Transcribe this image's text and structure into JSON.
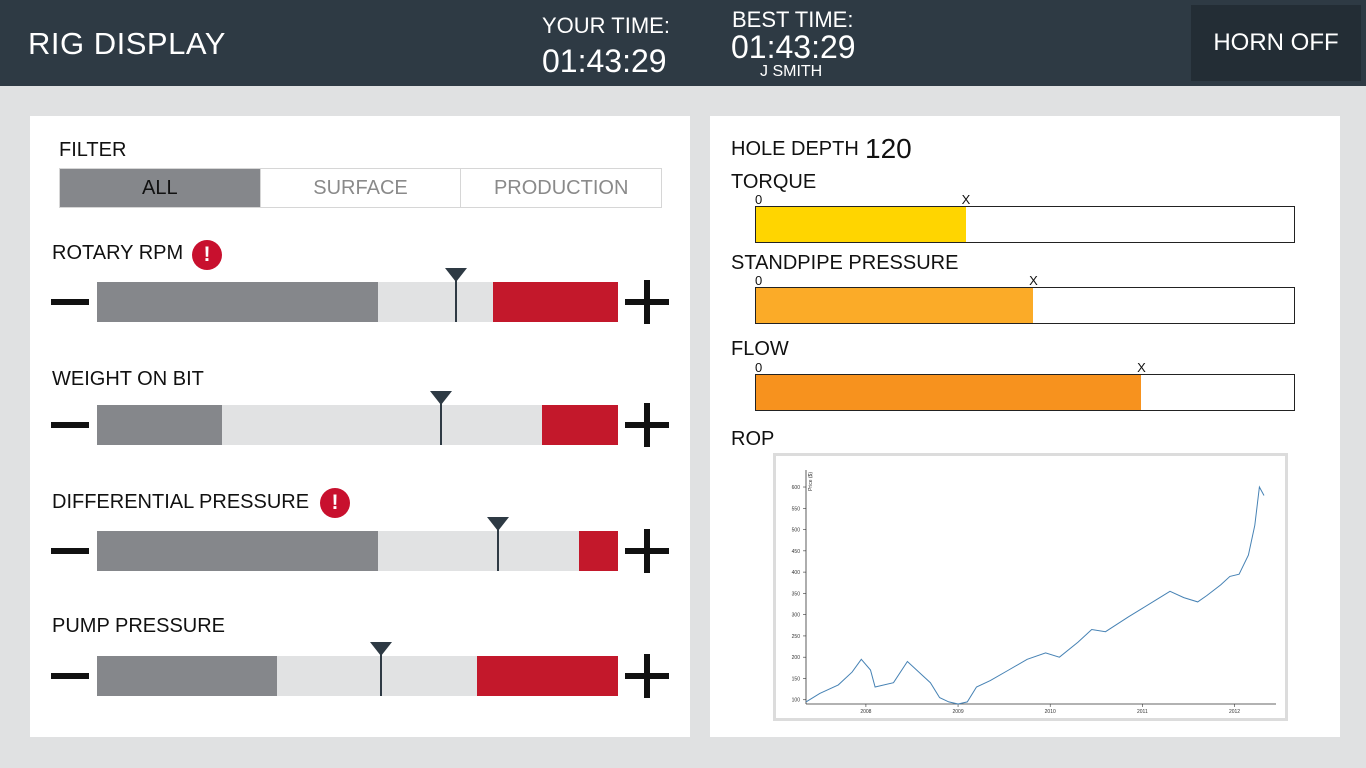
{
  "header": {
    "title": "RIG DISPLAY",
    "your_time_label": "YOUR TIME:",
    "your_time_value": "01:43:29",
    "best_time_label": "BEST TIME:",
    "best_time_value": "01:43:29",
    "best_time_holder": "J SMITH",
    "horn_button": "HORN OFF"
  },
  "filter": {
    "label": "FILTER",
    "tabs": [
      {
        "label": "ALL",
        "active": true
      },
      {
        "label": "SURFACE",
        "active": false
      },
      {
        "label": "PRODUCTION",
        "active": false
      }
    ]
  },
  "controls": [
    {
      "label": "ROTARY RPM",
      "warning": true,
      "warning_glyph": "!",
      "fill_pct": 54,
      "danger_start_pct": 76,
      "marker_pct": 69
    },
    {
      "label": "WEIGHT ON BIT",
      "warning": false,
      "fill_pct": 24,
      "danger_start_pct": 85.5,
      "marker_pct": 66
    },
    {
      "label": "DIFFERENTIAL PRESSURE",
      "warning": true,
      "warning_glyph": "!",
      "fill_pct": 54,
      "danger_start_pct": 92.5,
      "marker_pct": 77
    },
    {
      "label": "PUMP PRESSURE",
      "warning": false,
      "fill_pct": 34.5,
      "danger_start_pct": 73,
      "marker_pct": 54.5
    }
  ],
  "right": {
    "hole_depth_label": "HOLE DEPTH",
    "hole_depth_value": "120",
    "gauges": [
      {
        "label": "TORQUE",
        "zero_label": "0",
        "marker_label": "X",
        "fill_pct": 39,
        "color": "#ffd500"
      },
      {
        "label": "STANDPIPE PRESSURE",
        "zero_label": "0",
        "marker_label": "X",
        "fill_pct": 51.5,
        "color": "#fbab28"
      },
      {
        "label": "FLOW",
        "zero_label": "0",
        "marker_label": "X",
        "fill_pct": 71.5,
        "color": "#f7921e"
      }
    ],
    "rop_label": "ROP"
  },
  "colors": {
    "header_bg": "#2e3a44",
    "danger": "#c3182b",
    "fill_grey": "#85878b",
    "line": "#4682b4"
  },
  "rop_chart": {
    "ylabel": "Price ($)",
    "y_ticks": [
      "100",
      "150",
      "200",
      "250",
      "300",
      "350",
      "400",
      "450",
      "500",
      "550",
      "600"
    ],
    "x_ticks": [
      "2008",
      "2009",
      "2010",
      "2011",
      "2012"
    ]
  },
  "chart_data": {
    "type": "line",
    "title": "",
    "xlabel": "",
    "ylabel": "Price ($)",
    "xlim": [
      2007.35,
      2012.45
    ],
    "ylim": [
      90,
      640
    ],
    "x": [
      2007.35,
      2007.5,
      2007.7,
      2007.85,
      2007.95,
      2008.05,
      2008.1,
      2008.3,
      2008.45,
      2008.6,
      2008.7,
      2008.8,
      2008.9,
      2009.0,
      2009.1,
      2009.2,
      2009.35,
      2009.55,
      2009.75,
      2009.95,
      2010.1,
      2010.3,
      2010.45,
      2010.6,
      2010.85,
      2011.0,
      2011.15,
      2011.3,
      2011.45,
      2011.6,
      2011.7,
      2011.85,
      2011.95,
      2012.05,
      2012.15,
      2012.22,
      2012.27,
      2012.32
    ],
    "y": [
      95,
      115,
      135,
      165,
      195,
      170,
      130,
      140,
      190,
      160,
      140,
      105,
      95,
      90,
      95,
      130,
      145,
      170,
      195,
      210,
      200,
      235,
      265,
      260,
      295,
      315,
      335,
      355,
      340,
      330,
      345,
      370,
      390,
      395,
      440,
      510,
      600,
      580
    ]
  }
}
